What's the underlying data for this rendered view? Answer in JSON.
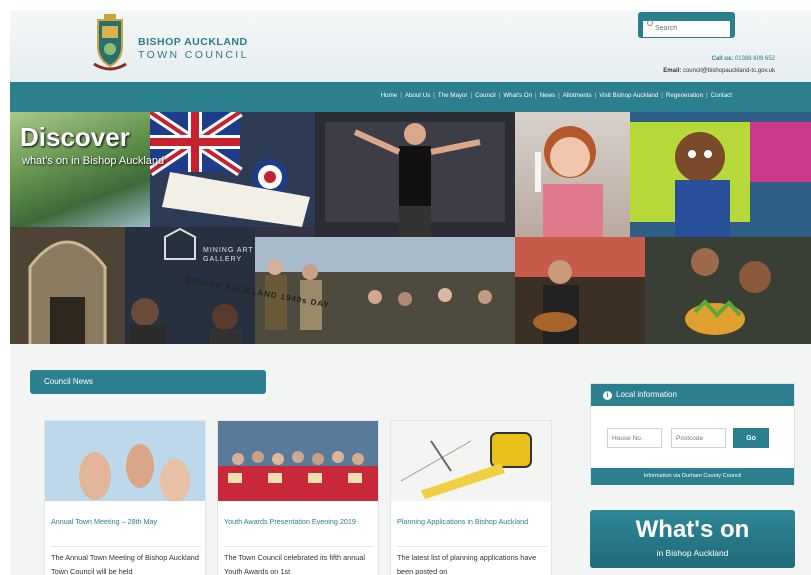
{
  "header": {
    "logo_line1": "BISHOP AUCKLAND",
    "logo_line2": "TOWN COUNCIL",
    "search_placeholder": "Search",
    "call_label": "Call us:",
    "call_value": "01388 609 652",
    "email_label": "Email:",
    "email_value": "council@bishopauckland-tc.gov.uk"
  },
  "nav": {
    "items": [
      "Home",
      "About Us",
      "The Mayor",
      "Council",
      "What's On",
      "News",
      "Allotments",
      "Visit Bishop Auckland",
      "Regeneration",
      "Contact"
    ]
  },
  "hero": {
    "title": "Discover",
    "subtitle": "what's on in Bishop Auckland",
    "sign_text": "BISHOP AUCKLAND 1940s DAY",
    "gallery_text_1": "MINING ART",
    "gallery_text_2": "GALLERY"
  },
  "news": {
    "tab_label": "Council News",
    "cards": [
      {
        "title": "Annual Town Meeting – 28th May",
        "text": "The Annual Town Meeting of Bishop Auckland Town Council will be held"
      },
      {
        "title": "Youth Awards Presentation Evening 2019",
        "text": "The Town Council celebrated its fifth annual Youth Awards on 1st"
      },
      {
        "title": "Planning Applications in Bishop Auckland",
        "text": "The latest list of planning applications have been posted on"
      }
    ]
  },
  "local": {
    "title": "Local information",
    "house_placeholder": "House No.",
    "postcode_placeholder": "Postcode",
    "go_label": "Go",
    "footer": "Information via Durham County Council"
  },
  "whatson": {
    "big": "What's on",
    "small": "in Bishop Auckland"
  },
  "colors": {
    "brand_teal": "#2b7f8f"
  }
}
